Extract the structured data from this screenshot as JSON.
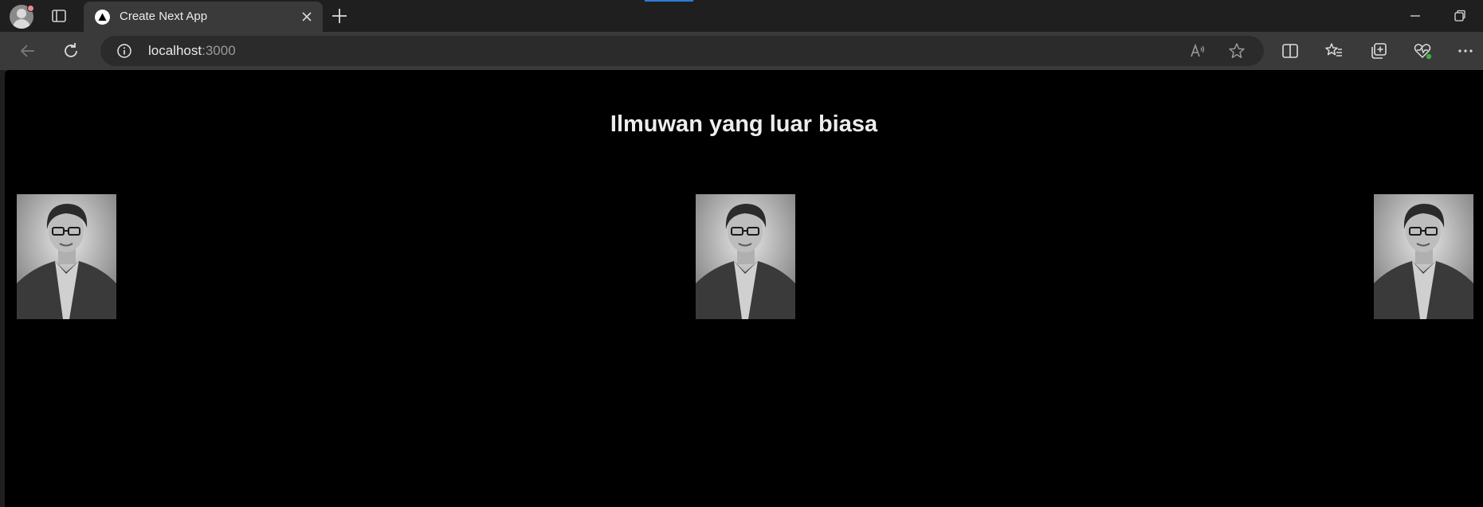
{
  "browser": {
    "tab_title": "Create Next App",
    "url_host": "localhost",
    "url_port": ":3000",
    "icons": {
      "profile": "profile-avatar-icon",
      "tab_actions": "tab-actions-icon",
      "favicon": "nextjs-triangle-icon",
      "tab_close": "close-icon",
      "new_tab": "plus-icon",
      "back": "back-arrow-icon",
      "reload": "reload-icon",
      "site_info": "info-icon",
      "read_aloud": "read-aloud-icon",
      "favorite": "star-icon",
      "split_screen": "split-screen-icon",
      "favorites": "favorites-list-icon",
      "collections": "collections-icon",
      "performance": "heartbeat-icon",
      "more": "more-dots-icon",
      "minimize": "minimize-icon",
      "restore": "restore-icon"
    }
  },
  "page": {
    "heading": "Ilmuwan yang luar biasa",
    "background_color": "#000000",
    "heading_color": "#ededed",
    "photos": [
      {
        "subject": "scientist-portrait"
      },
      {
        "subject": "scientist-portrait"
      },
      {
        "subject": "scientist-portrait"
      }
    ]
  }
}
